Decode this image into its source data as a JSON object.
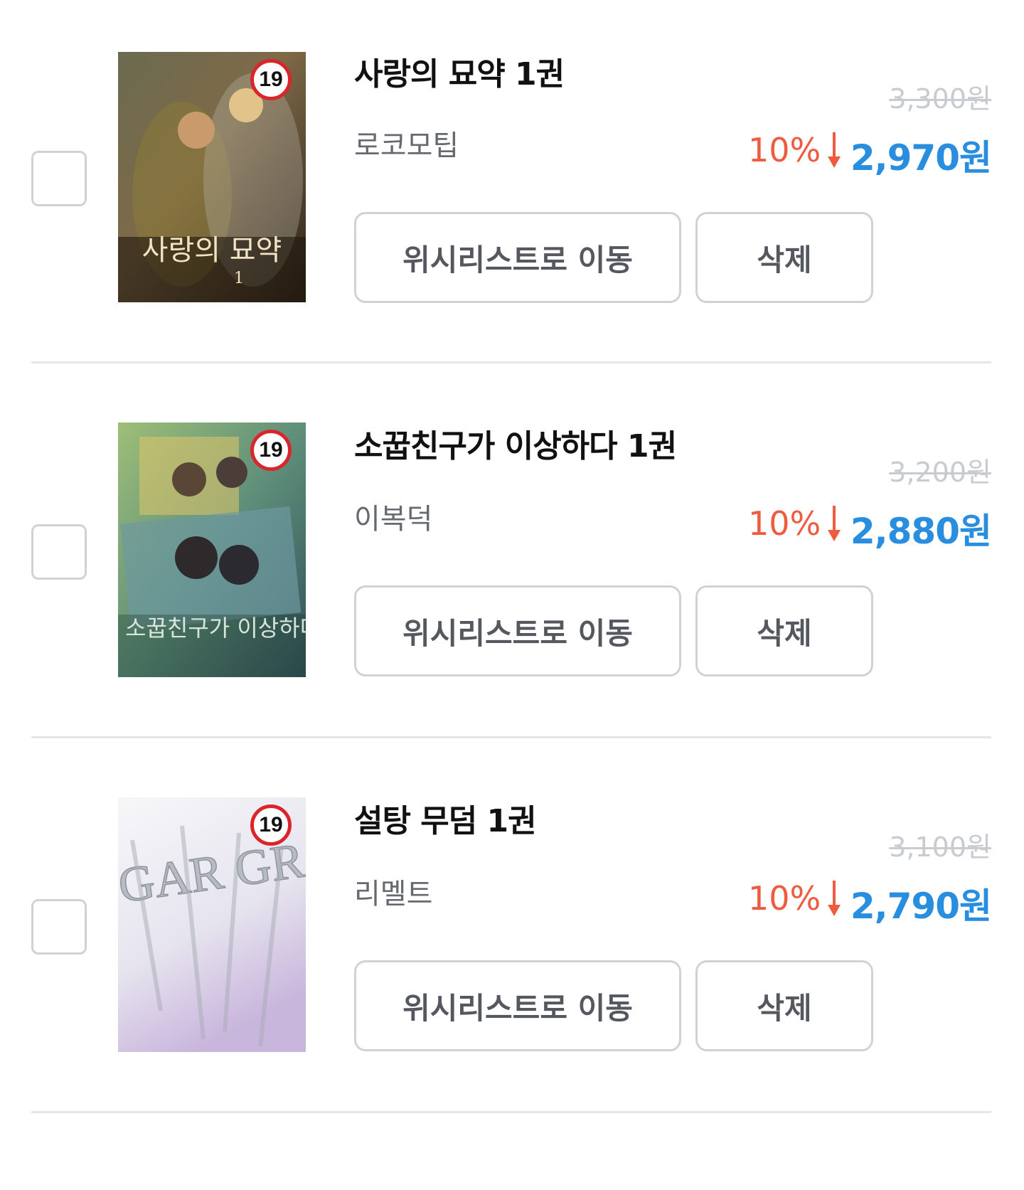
{
  "items": [
    {
      "title": "사랑의 묘약 1권",
      "author": "로코모팁",
      "original_price": "3,300원",
      "discount": "10%",
      "sale_price": "2,970원",
      "age_badge": "19",
      "move_label": "위시리스트로 이동",
      "delete_label": "삭제",
      "cover_text": "사랑의 묘약",
      "cover_number": "1"
    },
    {
      "title": "소꿉친구가 이상하다 1권",
      "author": "이복덕",
      "original_price": "3,200원",
      "discount": "10%",
      "sale_price": "2,880원",
      "age_badge": "19",
      "move_label": "위시리스트로 이동",
      "delete_label": "삭제",
      "cover_text": "소꿉친구가 이상하다"
    },
    {
      "title": "설탕 무덤 1권",
      "author": "리멜트",
      "original_price": "3,100원",
      "discount": "10%",
      "sale_price": "2,790원",
      "age_badge": "19",
      "move_label": "위시리스트로 이동",
      "delete_label": "삭제",
      "cover_text": "A SUGAR GRAVE"
    }
  ],
  "colors": {
    "discount": "#ef5b3f",
    "sale_price": "#2a8ee0",
    "original_price": "#c8cbd0",
    "border": "#cfd3d8",
    "badge_ring": "#d9252b"
  }
}
